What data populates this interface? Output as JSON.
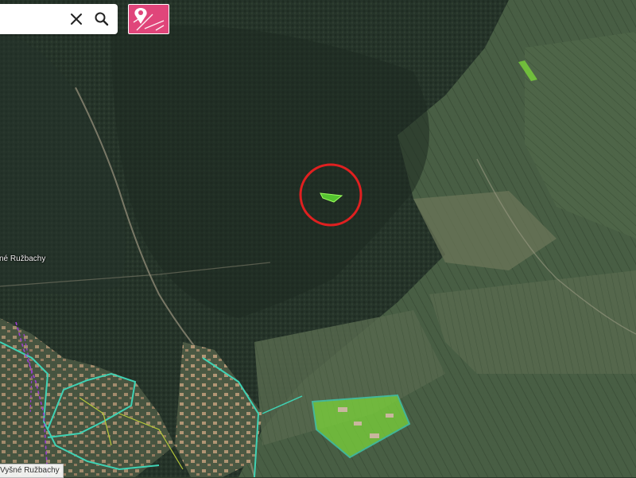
{
  "search": {
    "value": "",
    "placeholder": ""
  },
  "icons": {
    "clear": "close-icon",
    "search": "search-icon",
    "parcel": "map-pin-parcel-icon"
  },
  "labels": {
    "town_ghost": "vné Ružbachy",
    "town": "Vyšné Ružbachy"
  },
  "colors": {
    "parcel_button": "#e0457a",
    "highlight_circle": "#e02020",
    "boundary": "#3fd2b4",
    "cadastral_line": "#9b3fd0",
    "selected_parcel": "#7bd43a"
  }
}
